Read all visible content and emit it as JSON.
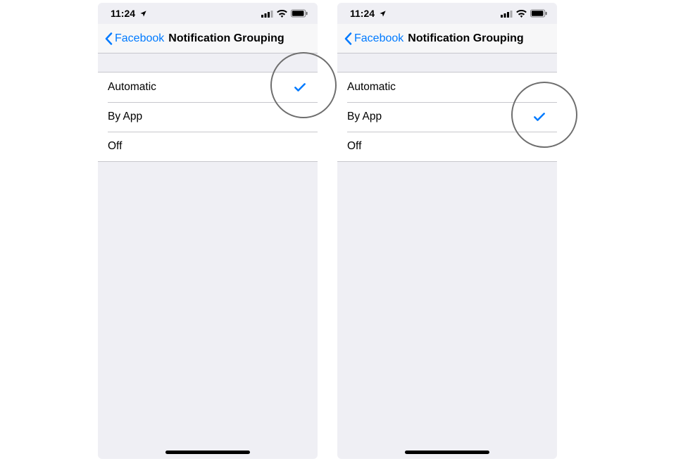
{
  "status": {
    "time": "11:24"
  },
  "nav": {
    "back_label": "Facebook",
    "title": "Notification Grouping"
  },
  "options": {
    "automatic": "Automatic",
    "by_app": "By App",
    "off": "Off"
  },
  "screens": [
    {
      "selected": "automatic"
    },
    {
      "selected": "by_app"
    }
  ],
  "colors": {
    "ios_blue": "#007aff",
    "separator": "#c7c7cc",
    "group_bg": "#efeff4"
  }
}
